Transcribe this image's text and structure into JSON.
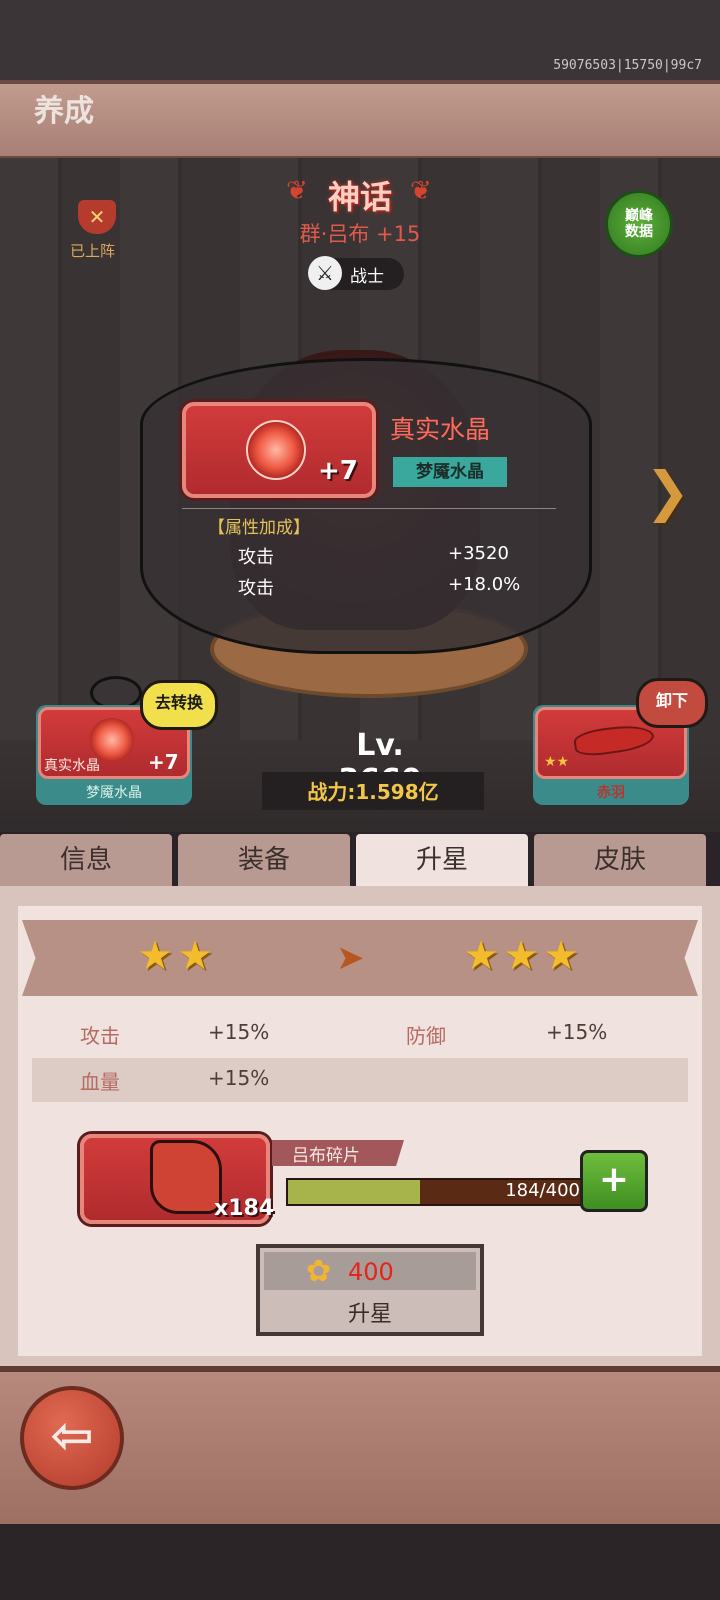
{
  "build_id": "59076503|15750|99c7",
  "header": {
    "title": "养成"
  },
  "hero": {
    "deployed_label": "已上阵",
    "rarity": "神话",
    "name": "群·吕布 +15",
    "class_label": "战士",
    "peak_data_label": "巅峰\n数据",
    "level": "Lv. 3660",
    "power": "战力:1.598亿"
  },
  "tooltip": {
    "item_name": "真实水晶",
    "item_plus": "+7",
    "item_type": "梦魇水晶",
    "bonus_title": "【属性加成】",
    "bonuses": [
      {
        "label": "攻击",
        "value": "+3520"
      },
      {
        "label": "攻击",
        "value": "+18.0%"
      }
    ]
  },
  "left_card": {
    "name": "真实水晶",
    "plus": "+7",
    "type": "梦魇水晶",
    "action_label": "去转换"
  },
  "right_card": {
    "name": "赤羽",
    "stars": 2,
    "action_label": "卸下"
  },
  "tabs": [
    {
      "label": "信息",
      "active": false
    },
    {
      "label": "装备",
      "active": false
    },
    {
      "label": "升星",
      "active": true
    },
    {
      "label": "皮肤",
      "active": false
    }
  ],
  "star_upgrade": {
    "current_stars": 2,
    "next_stars": 3,
    "stats": [
      {
        "label": "攻击",
        "value": "+15%"
      },
      {
        "label": "防御",
        "value": "+15%"
      },
      {
        "label": "血量",
        "value": "+15%"
      }
    ]
  },
  "shard": {
    "name": "吕布碎片",
    "count": "x184",
    "progress_text": "184/400",
    "progress_fraction": 0.46,
    "add_label": "+"
  },
  "upgrade": {
    "cost": "400",
    "label": "升星"
  },
  "colors": {
    "accent_red": "#d23b3b",
    "gold": "#f1c64a",
    "teal": "#3aa89c",
    "green_button": "#5fae3a"
  }
}
